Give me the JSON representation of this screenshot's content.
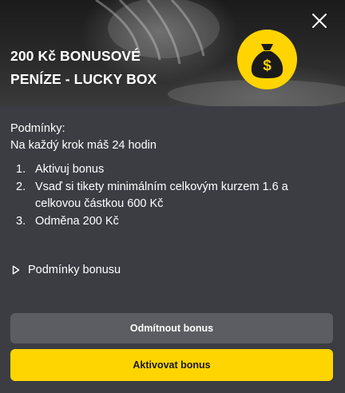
{
  "header": {
    "title_line1": "200 Kč BONUSOVÉ",
    "title_line2": "PENÍZE - LUCKY BOX",
    "close_icon": "close-icon",
    "badge_icon": "money-bag-icon",
    "badge_symbol": "$",
    "badge_color": "#FFD400"
  },
  "conditions": {
    "heading": "Podmínky:",
    "deadline": "Na každý krok máš 24 hodin",
    "steps": [
      {
        "number": "1.",
        "text": "Aktivuj bonus"
      },
      {
        "number": "2.",
        "text": "Vsaď si tikety minimálním celkovým kurzem 1.6 a celkovou částkou 600 Kč"
      },
      {
        "number": "3.",
        "text": "Odměna 200 Kč"
      }
    ]
  },
  "terms_link": {
    "label": "Podmínky bonusu",
    "icon": "play-outline-icon"
  },
  "actions": {
    "decline_label": "Odmítnout bonus",
    "activate_label": "Aktivovat bonus",
    "activate_color": "#FFD500"
  }
}
